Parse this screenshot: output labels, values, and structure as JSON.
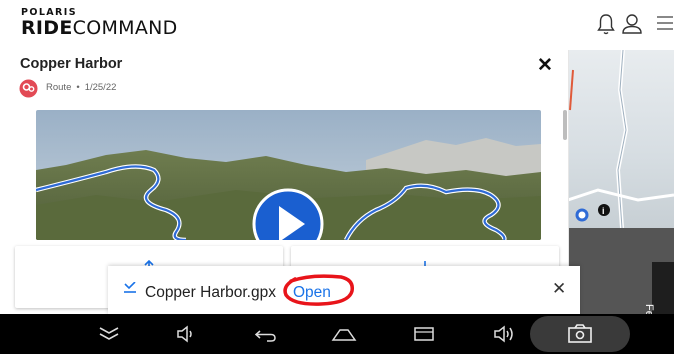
{
  "header": {
    "logo_top": "POLARIS",
    "logo_bold": "RIDE",
    "logo_rest": "COMMAND",
    "icons": [
      "bell-icon",
      "user-icon",
      "menu-icon"
    ]
  },
  "route": {
    "title": "Copper Harbor",
    "type": "Route",
    "separator": "•",
    "date": "1/25/22",
    "close_label": "✕"
  },
  "download": {
    "icon": "download-done-icon",
    "filename": "Copper Harbor.gpx",
    "open_label": "Open",
    "close_label": "✕"
  },
  "feedback_label": "Feedb",
  "navbar": {
    "buttons": [
      "hide-keyboard-icon",
      "volume-down-icon",
      "back-icon",
      "home-icon",
      "recents-icon",
      "volume-up-icon",
      "screenshot-icon"
    ]
  },
  "colors": {
    "accent": "#1a73e8",
    "pin": "#e24a55",
    "annotation": "#e8141a",
    "route_line": "#2f6bd6"
  }
}
